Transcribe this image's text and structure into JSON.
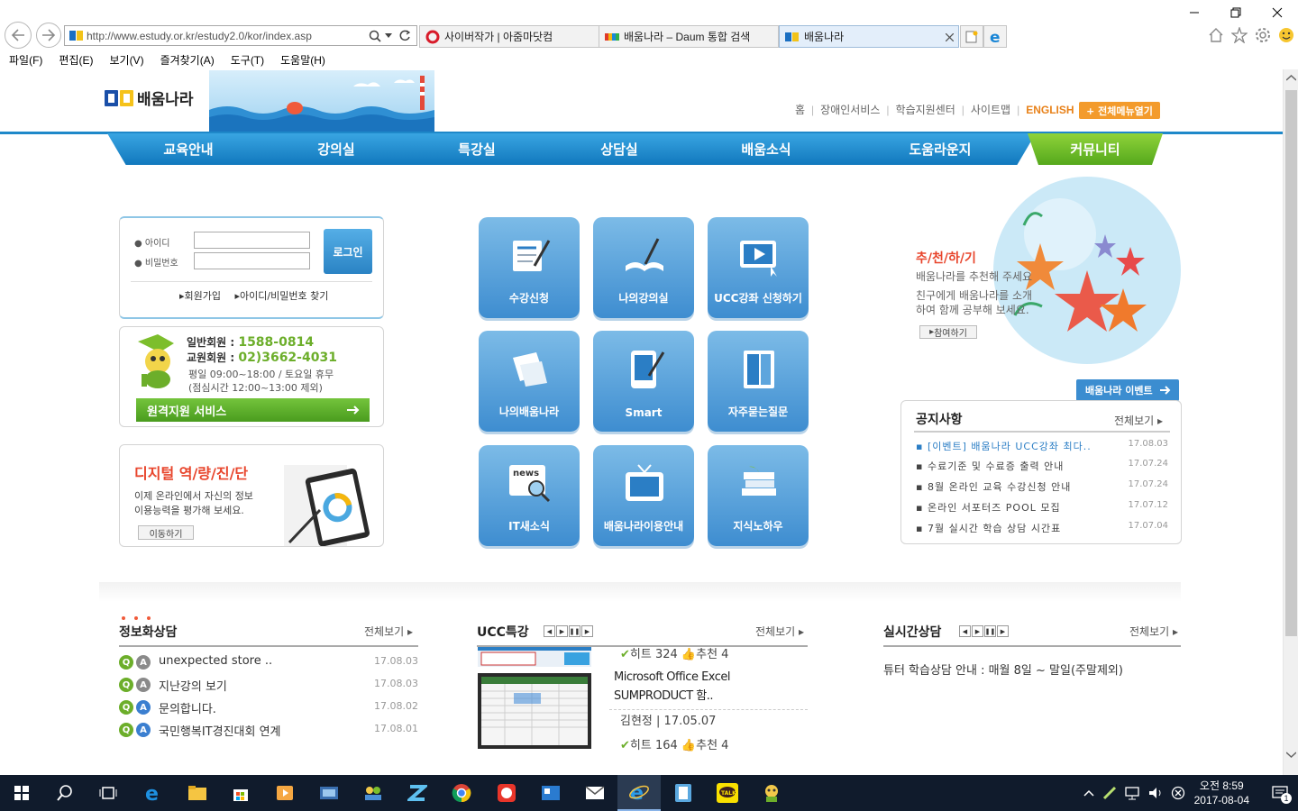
{
  "browser": {
    "back_icon": "back-arrow-icon",
    "forward_icon": "forward-arrow-icon",
    "url": "http://www.estudy.or.kr/estudy2.0/kor/index.asp",
    "tabs": [
      {
        "label": "사이버작가 | 아줌마닷컴",
        "active": false
      },
      {
        "label": "배움나라 – Daum 통합 검색",
        "active": false
      },
      {
        "label": "배움나라",
        "active": true
      }
    ],
    "menu": [
      "파일(F)",
      "편집(E)",
      "보기(V)",
      "즐겨찾기(A)",
      "도구(T)",
      "도움말(H)"
    ]
  },
  "site": {
    "logo_text": "배움나라",
    "top_links": [
      "홈",
      "장애인서비스",
      "학습지원센터",
      "사이트맵",
      "ENGLISH"
    ],
    "full_menu": "+ 전체메뉴열기",
    "gnb": [
      "교육안내",
      "강의실",
      "특강실",
      "상담실",
      "배움소식",
      "도움라운지"
    ],
    "gnb_community": "커뮤니티"
  },
  "login": {
    "id_label": "아이디",
    "pw_label": "비밀번호",
    "button": "로그인",
    "join": "회원가입",
    "find": "아이디/비밀번호 찾기"
  },
  "contact": {
    "general_label": "일반회원 :",
    "general_phone": "1588-0814",
    "teacher_label": "교원회원 :",
    "teacher_phone": "02)3662-4031",
    "hours": "평일 09:00~18:00 / 토요일 휴무",
    "lunch": "(점심시간 12:00~13:00 제외)",
    "remote": "원격지원 서비스"
  },
  "digital": {
    "title": "디지털 역/량/진/단",
    "desc1": "이제 온라인에서 자신의 정보",
    "desc2": "이용능력을 평가해 보세요.",
    "button": "이동하기"
  },
  "tiles": [
    "수강신청",
    "나의강의실",
    "UCC강좌 신청하기",
    "나의배움나라",
    "Smart",
    "자주묻는질문",
    "IT새소식",
    "배움나라이용안내",
    "지식노하우"
  ],
  "tile_news_label": "news",
  "recommend": {
    "title": "추/천/하/기",
    "line1": "배움나라를 추천해 주세요",
    "line2": "친구에게 배움나라를 소개",
    "line3": "하여 함께 공부해 보세요.",
    "button": "참여하기"
  },
  "event_button": "배움나라 이벤트",
  "notice": {
    "title": "공지사항",
    "more": "전체보기",
    "items": [
      {
        "title": "[이벤트] 배움나라 UCC강좌 최다..",
        "date": "17.08.03"
      },
      {
        "title": "수료기준 및 수료증 출력 안내",
        "date": "17.07.24"
      },
      {
        "title": "8월 온라인 교육 수강신청 안내",
        "date": "17.07.24"
      },
      {
        "title": "온라인 서포터즈 POOL 모집",
        "date": "17.07.12"
      },
      {
        "title": "7월 실시간 학습 상담 시간표",
        "date": "17.07.04"
      }
    ]
  },
  "qna": {
    "title": "정보화상담",
    "more": "전체보기",
    "q_badge": "Q",
    "a_badge": "A",
    "items": [
      {
        "title": "unexpected store ..",
        "date": "17.08.03"
      },
      {
        "title": "지난강의 보기",
        "date": "17.08.03"
      },
      {
        "title": "문의합니다.",
        "date": "17.08.02"
      },
      {
        "title": "국민행복IT경진대회 연계",
        "date": "17.08.01"
      }
    ]
  },
  "ucc": {
    "title": "UCC특강",
    "more": "전체보기",
    "top_hits": "히트 324",
    "top_recs": "추천 4",
    "item_title1": "Microsoft Office Excel",
    "item_title2": "SUMPRODUCT 함..",
    "item_author": "김현정 |",
    "item_date": "17.05.07",
    "item_hits": "히트 164",
    "item_recs": "추천 4"
  },
  "realtime": {
    "title": "실시간상담",
    "more": "전체보기",
    "text": "튜터 학습상담 안내 : 매월 8일 ~ 말일(주말제외)"
  },
  "taskbar": {
    "time": "오전 8:59",
    "date": "2017-08-04",
    "notif_count": "1"
  }
}
